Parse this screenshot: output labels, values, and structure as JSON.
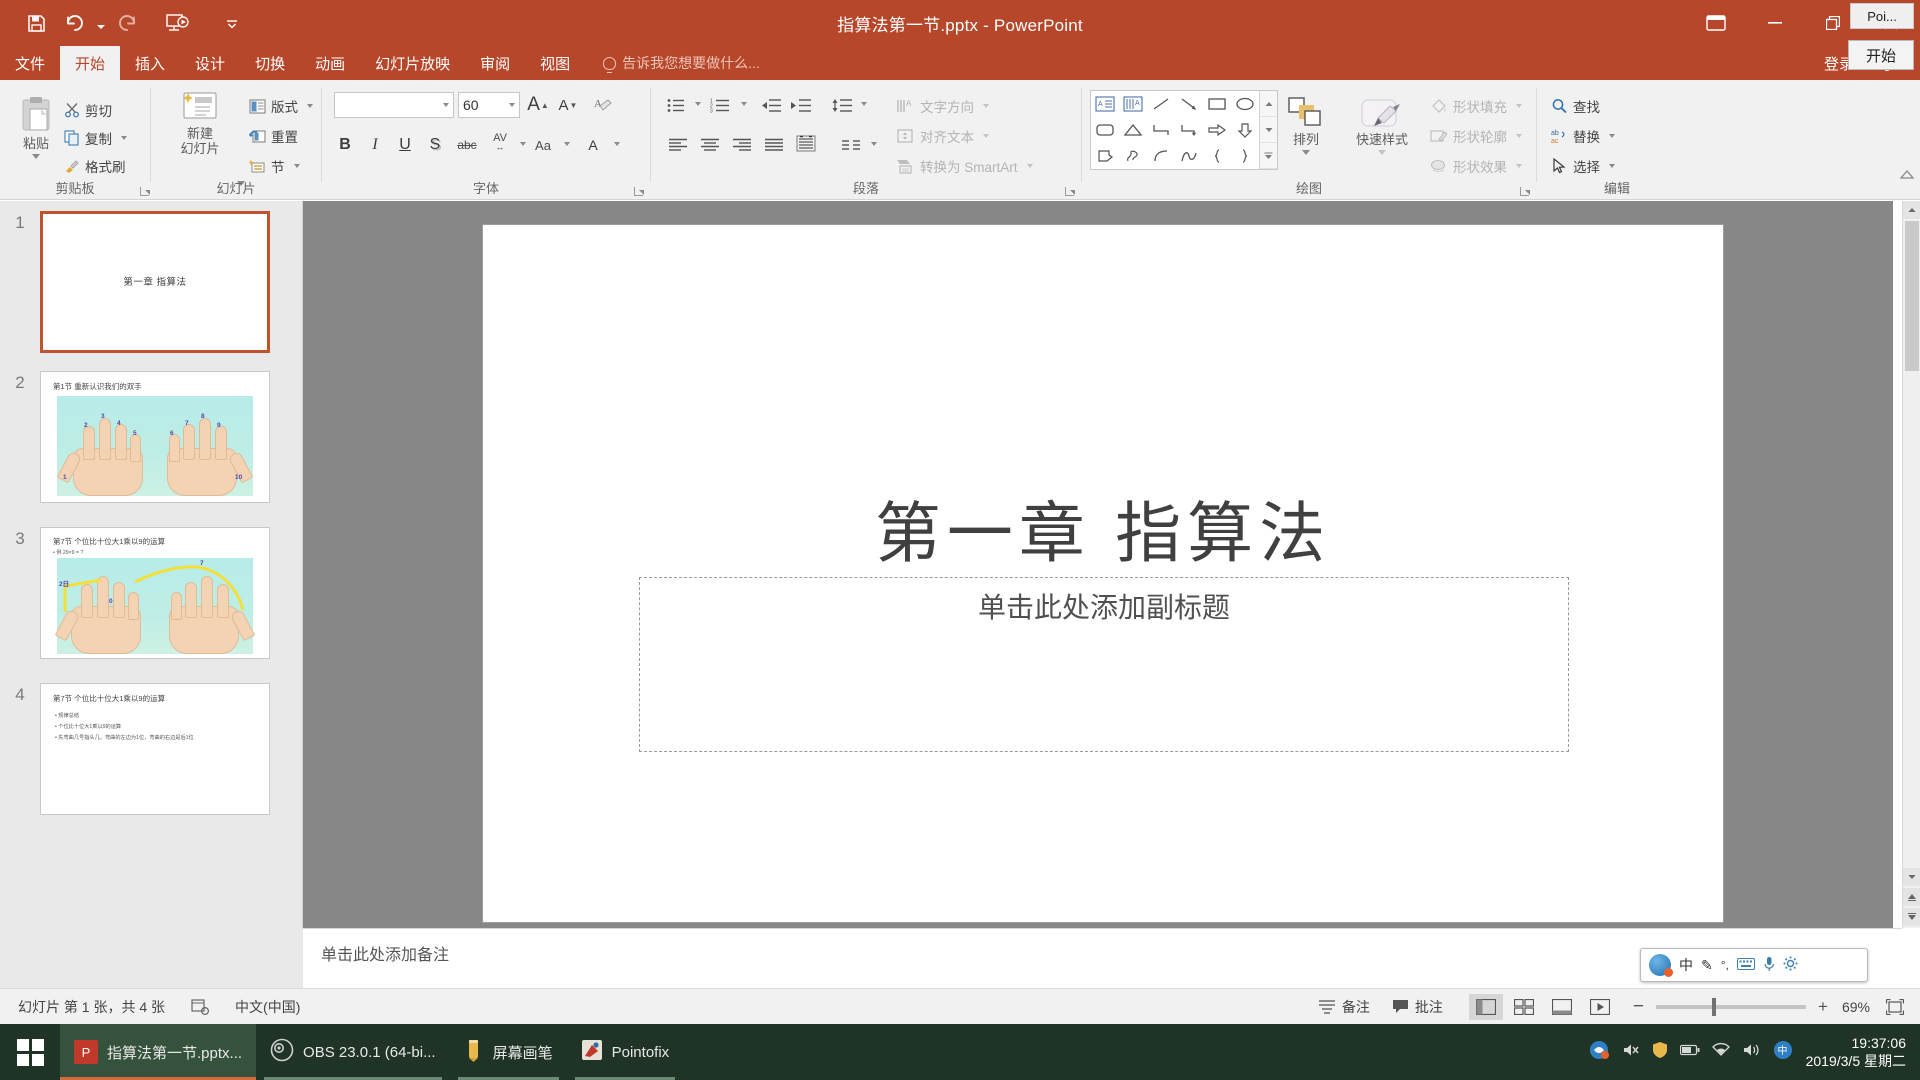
{
  "window": {
    "title": "指算法第一节.pptx - PowerPoint",
    "accent_color": "#b7472a",
    "minimize_label": "—",
    "restore_label": "❐",
    "close_label": "✕",
    "ribbon_display_label": "⊡",
    "poi_chip_label": "Poi...",
    "poi_chip2_label": "开始"
  },
  "quick_access": [
    {
      "name": "save-icon",
      "label": "保存"
    },
    {
      "name": "undo-icon",
      "label": "撤消"
    },
    {
      "name": "redo-icon",
      "label": "重复"
    },
    {
      "name": "start-slideshow-icon",
      "label": "从头开始"
    },
    {
      "name": "customize-qat-icon",
      "label": "自定义快速访问工具栏"
    }
  ],
  "tabs": [
    {
      "label": "文件",
      "active": false
    },
    {
      "label": "开始",
      "active": true
    },
    {
      "label": "插入",
      "active": false
    },
    {
      "label": "设计",
      "active": false
    },
    {
      "label": "切换",
      "active": false
    },
    {
      "label": "动画",
      "active": false
    },
    {
      "label": "幻灯片放映",
      "active": false
    },
    {
      "label": "审阅",
      "active": false
    },
    {
      "label": "视图",
      "active": false
    }
  ],
  "tell_me": "告诉我您想要做什么...",
  "sign_in": "登录",
  "ribbon": {
    "groups": [
      {
        "label": "剪贴板"
      },
      {
        "label": "幻灯片"
      },
      {
        "label": "字体"
      },
      {
        "label": "段落"
      },
      {
        "label": "绘图"
      },
      {
        "label": "编辑"
      }
    ],
    "clipboard": {
      "paste": "粘贴",
      "cut": "剪切",
      "copy": "复制",
      "format_painter": "格式刷"
    },
    "slides": {
      "new_slide_line1": "新建",
      "new_slide_line2": "幻灯片",
      "layout": "版式",
      "reset": "重置",
      "section": "节"
    },
    "font": {
      "font_name": "",
      "font_size": "60",
      "grow_font": "A",
      "shrink_font": "A",
      "clear_formatting": "清除所有格式",
      "bold": "B",
      "italic": "I",
      "underline": "U",
      "shadow": "S",
      "strikethrough": "abc",
      "char_spacing": "AV",
      "change_case": "Aa",
      "font_color": "A"
    },
    "paragraph": {
      "bullets": "项目符号",
      "numbering": "编号",
      "decrease_indent": "减少缩进量",
      "increase_indent": "增加缩进量",
      "line_spacing": "行距",
      "align_left": "左对齐",
      "align_center": "居中",
      "align_right": "右对齐",
      "justify": "两端对齐",
      "distribute": "分散对齐",
      "columns": "分栏",
      "text_direction": "文字方向",
      "align_text": "对齐文本",
      "convert_smartart": "转换为 SmartArt"
    },
    "drawing": {
      "arrange": "排列",
      "quick_styles": "快速样式",
      "shape_fill": "形状填充",
      "shape_outline": "形状轮廓",
      "shape_effects": "形状效果"
    },
    "editing": {
      "find": "查找",
      "replace": "替换",
      "select": "选择"
    }
  },
  "thumbnails": [
    {
      "number": "1",
      "selected": true,
      "title": "第一章 指算法",
      "kind": "title"
    },
    {
      "number": "2",
      "selected": false,
      "title": "第1节 重新认识我们的双手",
      "kind": "hands-numbered",
      "finger_numbers": [
        "1",
        "2",
        "3",
        "4",
        "5",
        "6",
        "7",
        "8",
        "9",
        "10"
      ]
    },
    {
      "number": "3",
      "selected": false,
      "title": "第7节 个位比十位大1乘以9的运算",
      "kind": "hands-arc",
      "sub_line": "• 例  29×9 = ?",
      "labels": [
        "2日",
        "0",
        "7"
      ]
    },
    {
      "number": "4",
      "selected": false,
      "title": "第7节 个位比十位大1乘以9的运算",
      "kind": "bullets",
      "bullets": [
        "• 规律总结",
        "• 个位比十位大1乘以9的运算",
        "• 先弯曲几号指头几，弯曲的左边为1位，弯曲的右边是后1位"
      ]
    }
  ],
  "slide": {
    "title": "第一章 指算法",
    "subtitle_placeholder": "单击此处添加副标题"
  },
  "notes": {
    "placeholder": "单击此处添加备注"
  },
  "status_bar": {
    "slide_counter": "幻灯片 第 1 张，共 4 张",
    "accessibility_label": "辅助功能检查",
    "language": "中文(中国)",
    "notes_button": "备注",
    "comments_button": "批注",
    "views": [
      {
        "name": "normal-view",
        "label": "普通视图",
        "active": true
      },
      {
        "name": "slide-sorter-view",
        "label": "幻灯片浏览",
        "active": false
      },
      {
        "name": "reading-view",
        "label": "阅读视图",
        "active": false
      },
      {
        "name": "slideshow-view",
        "label": "幻灯片放映",
        "active": false
      }
    ],
    "zoom_out": "−",
    "zoom_in": "+",
    "zoom_level": "69%",
    "fit_window_label": "使幻灯片适应当前窗口"
  },
  "ime": {
    "logo_name": "sogou-ime-logo",
    "items": [
      "中",
      "✎",
      "°,",
      "⌨",
      "🎤",
      "⚙"
    ]
  },
  "taskbar": {
    "start_label": "开始",
    "apps": [
      {
        "label": "指算法第一节.pptx...",
        "icon": "powerpoint-icon",
        "active": true
      },
      {
        "label": "OBS 23.0.1 (64-bi...",
        "icon": "obs-icon",
        "active": false
      },
      {
        "label": "屏幕画笔",
        "icon": "screen-pen-icon",
        "active": false
      },
      {
        "label": "Pointofix",
        "icon": "pointofix-icon",
        "active": false
      }
    ],
    "tray_icons": [
      "sogou-tray-icon",
      "speaker-mute-icon",
      "shield-icon",
      "battery-icon",
      "network-icon",
      "volume-icon",
      "ime-tray-icon"
    ],
    "time": "19:37:06",
    "date": "2019/3/5 星期二"
  }
}
